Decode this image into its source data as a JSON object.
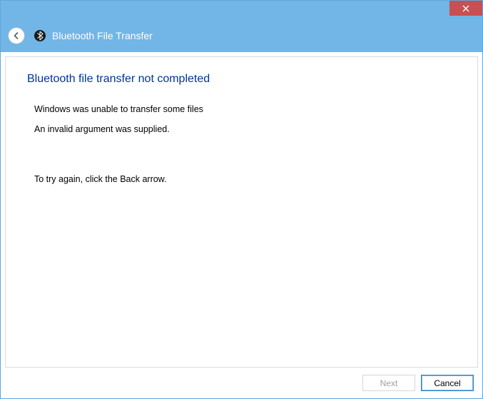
{
  "window": {
    "title": "Bluetooth File Transfer"
  },
  "page": {
    "heading": "Bluetooth file transfer not completed",
    "line1": "Windows was unable to transfer some files",
    "line2": "An invalid argument was supplied.",
    "line3": "To try again, click the Back arrow."
  },
  "buttons": {
    "next": "Next",
    "cancel": "Cancel"
  }
}
